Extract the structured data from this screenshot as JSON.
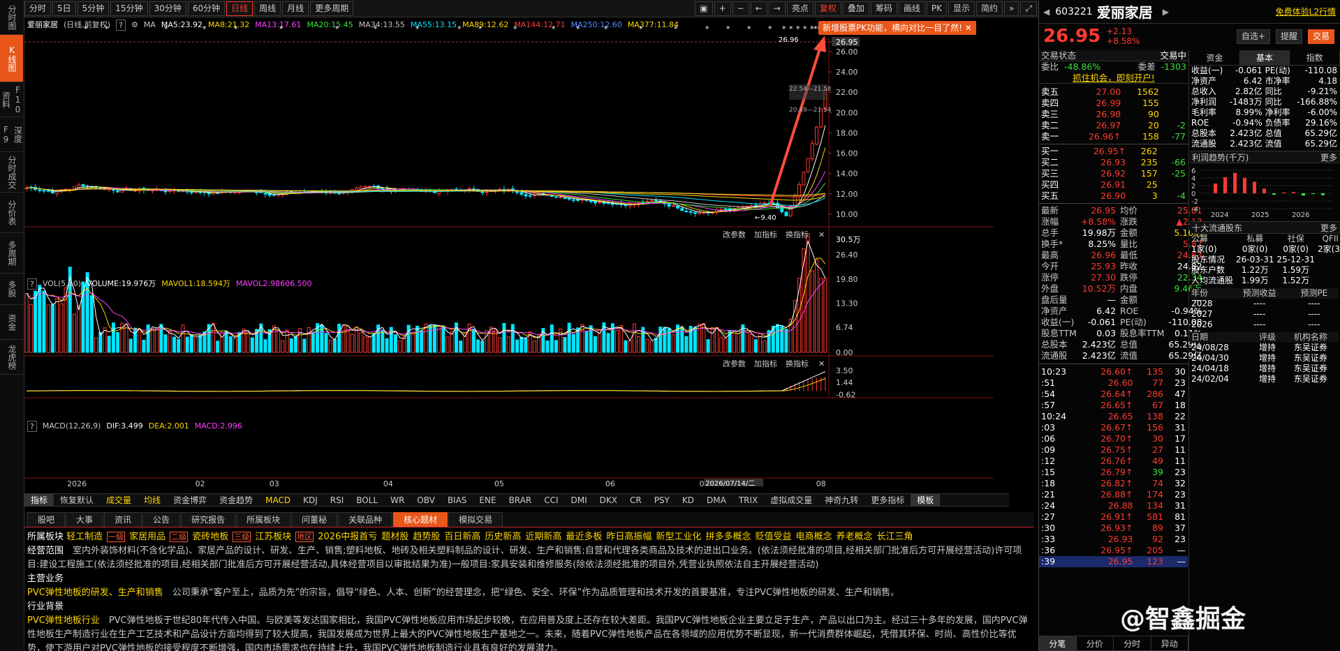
{
  "sidebar": [
    "分时图",
    "K线图",
    "F10资料",
    "深度F9",
    "分时成交",
    "分价表",
    "多周期",
    "多股",
    "资金",
    "龙虎榜"
  ],
  "toolbar": {
    "periods": [
      "分时",
      "5日",
      "5分钟",
      "15分钟",
      "30分钟",
      "60分钟",
      "日线",
      "周线",
      "月线",
      "更多周期"
    ],
    "tools": [
      "亮点",
      "复权",
      "叠加",
      "筹码",
      "画线",
      "PK",
      "显示",
      "简约"
    ]
  },
  "tip": "新增股票PK功能，横向对比一目了然!",
  "chart_header": {
    "name": "爱丽家居",
    "mode": "(日线,前复权)",
    "ma_label": "MA",
    "ma": [
      {
        "label": "MA5:23.92",
        "color": "#ffffff"
      },
      {
        "label": "MA8:21.32",
        "color": "#ffd700"
      },
      {
        "label": "MA13:17.61",
        "color": "#ff40ff"
      },
      {
        "label": "MA20:15.45",
        "color": "#3ce03c"
      },
      {
        "label": "MA34:13.55",
        "color": "#c8c8c8"
      },
      {
        "label": "MA55:13.15",
        "color": "#00e5ff"
      },
      {
        "label": "MA89:12.62",
        "color": "#ffd700"
      },
      {
        "label": "MA144:12.71",
        "color": "#ff3b30"
      },
      {
        "label": "MA250:12.60",
        "color": "#5a8cff"
      },
      {
        "label": "MA377:11.84",
        "color": "#ffd700"
      }
    ]
  },
  "price_axis": [
    "26.95",
    "26.00",
    "24.00",
    "22.00",
    "20.00",
    "18.00",
    "16.00",
    "14.00",
    "12.00",
    "10.00"
  ],
  "price_labels": {
    "high": "26.96",
    "low": "9.40",
    "mid1": "22.54—21.58",
    "mid2": "20.49—21.54"
  },
  "vol_header": {
    "name": "VOL(5,10)",
    "items": [
      {
        "label": "VOLUME:19.976万",
        "color": "#ffffff"
      },
      {
        "label": "MAVOL1:18.594万",
        "color": "#ffd700"
      },
      {
        "label": "MAVOL2:98606.500",
        "color": "#ff40ff"
      }
    ]
  },
  "vol_axis": [
    "30.5万",
    "26.40",
    "19.80",
    "13.30",
    "6.74",
    "0.00"
  ],
  "macd_header": {
    "name": "MACD(12,26,9)",
    "items": [
      {
        "label": "DIF:3.499",
        "color": "#ffffff"
      },
      {
        "label": "DEA:2.001",
        "color": "#ffd700"
      },
      {
        "label": "MACD:2.996",
        "color": "#ff40ff"
      }
    ]
  },
  "macd_axis": [
    "3.50",
    "1.44",
    "-0.62"
  ],
  "panel_actions": [
    "改参数",
    "加指标",
    "换指标"
  ],
  "x_axis": [
    "2026",
    "02",
    "03",
    "04",
    "05",
    "06",
    "07",
    "08"
  ],
  "x_cursor": "2026/07/14/二",
  "indicators": [
    "指标",
    "恢复默认",
    "成交量",
    "均线",
    "资金博弈",
    "资金趋势",
    "MACD",
    "KDJ",
    "RSI",
    "BOLL",
    "WR",
    "OBV",
    "BIAS",
    "ENE",
    "BRAR",
    "CCI",
    "DMI",
    "DKX",
    "CR",
    "PSY",
    "KD",
    "DMA",
    "TRIX",
    "虚拟成交量",
    "神奇九转",
    "更多指标",
    "模板"
  ],
  "info_tabs": [
    "股吧",
    "大事",
    "资讯",
    "公告",
    "研究报告",
    "所属板块",
    "问董秘",
    "关联品种",
    "核心题材",
    "模拟交易"
  ],
  "info": {
    "sector_label": "所属板块",
    "sectors": [
      "轻工制造",
      "一级",
      "家居用品",
      "二级",
      "瓷砖地板",
      "三级",
      "江苏板块",
      "地区",
      "2026中报首亏",
      "题材股",
      "趋势股",
      "百日新高",
      "历史新高",
      "近期新高",
      "最近多板",
      "昨日高振幅",
      "新型工业化",
      "拼多多概念",
      "贬值受益",
      "电商概念",
      "养老概念",
      "长江三角"
    ],
    "scope_label": "经营范围",
    "scope": "室内外装饰材料(不含化学品)、家居产品的设计、研发、生产、销售;塑料地板、地砖及相关塑料制品的设计、研发、生产和销售;自营和代理各类商品及技术的进出口业务。(依法须经批准的项目,经相关部门批准后方可开展经营活动)许可项目:建设工程施工(依法须经批准的项目,经相关部门批准后方可开展经营活动,具体经营项目以审批结果为准)一般项目:家具安装和维修服务(除依法须经批准的项目外,凭营业执照依法自主开展经营活动)",
    "main_label": "主营业务",
    "main_title": "PVC弹性地板的研发、生产和销售",
    "main_text": "公司秉承“客户至上，品质为先”的宗旨，倡导“绿色、人本、创新”的经营理念，把“绿色、安全、环保”作为品质管理和技术开发的首要基准，专注PVC弹性地板的研发、生产和销售。",
    "bg_label": "行业背景",
    "bg_title": "PVC弹性地板行业",
    "bg_text": "PVC弹性地板于世纪80年代传入中国。与欧美等发达国家相比，我国PVC弹性地板应用市场起步较晚，在应用普及度上还存在较大差距。我国PVC弹性地板企业主要立足于生产，产品以出口为主。经过三十多年的发展，国内PVC弹性地板生产制造行业在生产工艺技术和产品设计方面均得到了较大提高，我国发展成为世界上最大的PVC弹性地板生产基地之一。未来，随着PVC弹性地板产品在各领域的应用优势不断显现，新一代消费群体崛起，凭借其环保、时尚、高性价比等优势，使下游用户对PVC弹性地板的接受程度不断增强，国内市场需求也在持续上升，我国PVC弹性地板制造行业具有良好的发展潜力。"
  },
  "stock": {
    "code": "603221",
    "name": "爱丽家居",
    "price": "26.95",
    "change": "+2.13",
    "pct": "+8.58%",
    "promo": "免费体验L2行情",
    "buttons": [
      "自选+",
      "提醒",
      "交易"
    ]
  },
  "trade_header": [
    "交易状态",
    "交易中"
  ],
  "weibi": {
    "label1": "委比",
    "v1": "-48.86%",
    "label2": "委差",
    "v2": "-1303"
  },
  "open_account": "抓住机会，即刻开户!",
  "sells": [
    [
      "卖五",
      "27.00",
      "1562",
      ""
    ],
    [
      "卖四",
      "26.99",
      "155",
      ""
    ],
    [
      "卖三",
      "26.98",
      "90",
      ""
    ],
    [
      "卖二",
      "26.97",
      "20",
      "-2"
    ],
    [
      "卖一",
      "26.96↑",
      "158",
      "-77"
    ]
  ],
  "buys": [
    [
      "买一",
      "26.95↑",
      "262",
      ""
    ],
    [
      "买二",
      "26.93",
      "235",
      "-66"
    ],
    [
      "买三",
      "26.92",
      "157",
      "-25"
    ],
    [
      "买四",
      "26.91",
      "25",
      ""
    ],
    [
      "买五",
      "26.90",
      "3",
      "-4"
    ]
  ],
  "quote": [
    [
      "最新",
      "26.95",
      "red",
      "均价",
      "25.81",
      "red"
    ],
    [
      "涨幅",
      "+8.58%",
      "red",
      "涨跌",
      "▲2.13",
      "red"
    ],
    [
      "总手",
      "19.98万",
      "white",
      "金额",
      "5.16亿",
      "yellow"
    ],
    [
      "换手*",
      "8.25%",
      "white",
      "量比",
      "5.87",
      "red"
    ],
    [
      "最高",
      "26.96",
      "red",
      "最低",
      "24.83",
      "red"
    ],
    [
      "今开",
      "25.93",
      "red",
      "昨收",
      "24.82",
      "white"
    ],
    [
      "涨停",
      "27.30",
      "red",
      "跌停",
      "22.34",
      "green"
    ],
    [
      "外盘",
      "10.52万",
      "red",
      "内盘",
      "9.46万",
      "green"
    ],
    [
      "盘后量",
      "—",
      "white",
      "金额",
      "—",
      "white"
    ],
    [
      "净资产",
      "6.42",
      "white",
      "ROE",
      "-0.94%",
      "white"
    ],
    [
      "收益(一)",
      "-0.061",
      "white",
      "PE(动)",
      "-110.08",
      "white"
    ],
    [
      "股息TTM",
      "0.03",
      "white",
      "股息率TTM",
      "0.11%",
      "white"
    ],
    [
      "总股本",
      "2.423亿",
      "white",
      "总值",
      "65.29亿",
      "white"
    ],
    [
      "流通股",
      "2.423亿",
      "white",
      "流值",
      "65.29亿",
      "white"
    ]
  ],
  "ticks": [
    [
      "10:23",
      "26.60↑",
      "135",
      "30"
    ],
    [
      ":51",
      "26.60",
      "77",
      "23"
    ],
    [
      ":54",
      "26.64↑",
      "286",
      "47"
    ],
    [
      ":57",
      "26.65↑",
      "67",
      "18"
    ],
    [
      "10:24",
      "26.65",
      "138",
      "22"
    ],
    [
      ":03",
      "26.67↑",
      "156",
      "31"
    ],
    [
      ":06",
      "26.70↑",
      "30",
      "17"
    ],
    [
      ":09",
      "26.75↑",
      "27",
      "11"
    ],
    [
      ":12",
      "26.76↑",
      "49",
      "11"
    ],
    [
      ":15",
      "26.79↑",
      "39",
      "23"
    ],
    [
      ":18",
      "26.82↑",
      "74",
      "32"
    ],
    [
      ":21",
      "26.88↑",
      "174",
      "23"
    ],
    [
      ":24",
      "26.88",
      "134",
      "31"
    ],
    [
      ":27",
      "26.91↑",
      "581",
      "81"
    ],
    [
      ":30",
      "26.93↑",
      "89",
      "37"
    ],
    [
      ":33",
      "26.93",
      "92",
      "23"
    ],
    [
      ":36",
      "26.95↑",
      "205",
      "—"
    ],
    [
      ":39",
      "26.95",
      "123",
      "—"
    ]
  ],
  "bottom_tabs": [
    "分笔",
    "分价",
    "分时",
    "异动"
  ],
  "fund_tabs": [
    "资金",
    "基本",
    "指数"
  ],
  "fund": [
    [
      "收益(一)",
      "-0.061",
      "PE(动)",
      "-110.08"
    ],
    [
      "净资产",
      "6.42",
      "市净率",
      "4.18"
    ],
    [
      "总收入",
      "2.82亿",
      "同比",
      "-9.21%"
    ],
    [
      "净利润",
      "-1483万",
      "同比",
      "-166.88%"
    ],
    [
      "毛利率",
      "8.99%",
      "净利率",
      "-6.00%"
    ],
    [
      "ROE",
      "-0.94%",
      "负债率",
      "29.16%"
    ],
    [
      "总股本",
      "2.423亿",
      "总值",
      "65.29亿"
    ],
    [
      "流通股",
      "2.423亿",
      "流值",
      "65.29亿"
    ]
  ],
  "profit_title": "利润趋势(千万)",
  "more": "更多",
  "profit_axis": [
    "6",
    "4",
    "2",
    "0",
    "-2",
    "-4"
  ],
  "profit_years": [
    "2024",
    "2025",
    "2026"
  ],
  "profit_bars": [
    2.5,
    4.2,
    5.3,
    4.0,
    3.0,
    1.2,
    -0.4,
    0.2,
    0.3,
    -0.6,
    -0.2,
    -0.5
  ],
  "holders_title": "十大流通股东",
  "holders_head": [
    "公募",
    "私募",
    "社保",
    "QFII"
  ],
  "holders_vals": [
    "1家(0)",
    "0家(0)",
    "0家(0)",
    "2家(3)"
  ],
  "holders_rows": [
    [
      "股东情况",
      "26-03-31",
      "25-12-31"
    ],
    [
      "股东户数",
      "1.22万",
      "1.59万"
    ],
    [
      "人均流通股",
      "1.99万",
      "1.52万"
    ]
  ],
  "forecast_head": [
    "年份",
    "预测收益",
    "预测PE"
  ],
  "forecast_rows": [
    [
      "2028",
      "----",
      "----"
    ],
    [
      "2027",
      "----",
      "----"
    ],
    [
      "2026",
      "----",
      "----"
    ]
  ],
  "rating_head": [
    "日期",
    "评级",
    "机构名称"
  ],
  "rating_rows": [
    [
      "24/08/28",
      "增持",
      "东吴证券"
    ],
    [
      "24/04/30",
      "增持",
      "东吴证券"
    ],
    [
      "24/04/18",
      "增持",
      "东吴证券"
    ],
    [
      "24/02/04",
      "增持",
      "东吴证券"
    ]
  ],
  "watermark": "@智鑫掘金"
}
